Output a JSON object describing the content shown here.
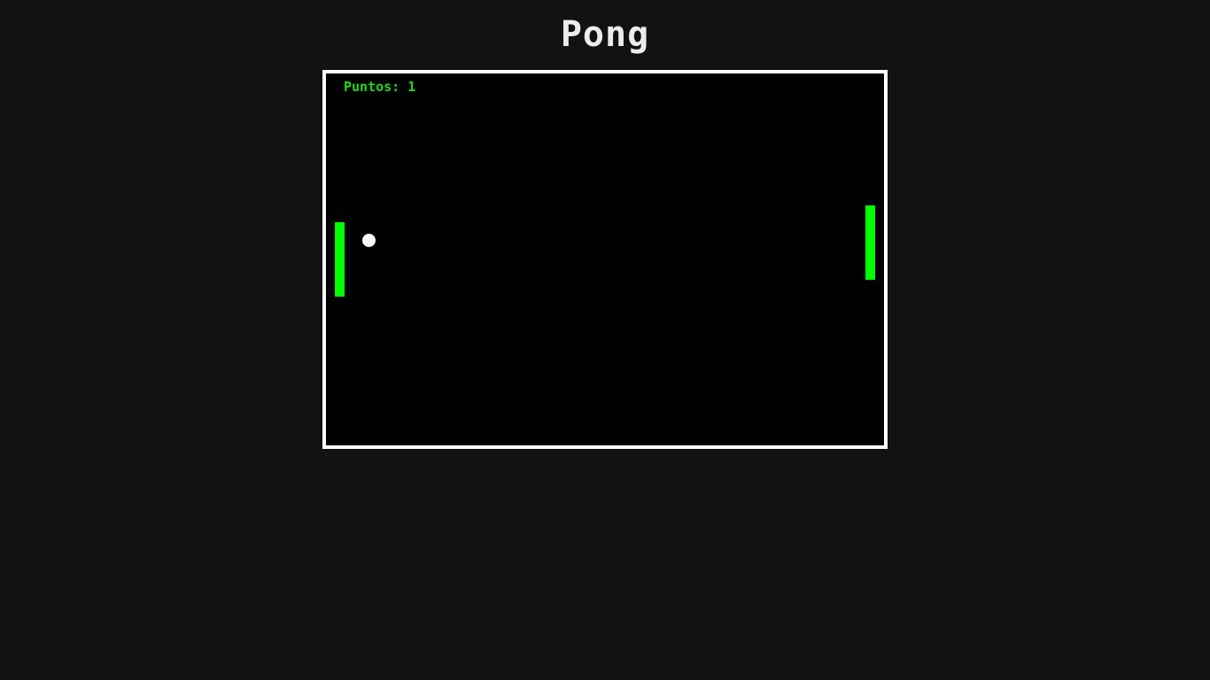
{
  "title": "Pong",
  "game": {
    "score_label": "Puntos:",
    "score_value": "1",
    "colors": {
      "background": "#121212",
      "board": "#000000",
      "border": "#ffffff",
      "paddle": "#00ff00",
      "ball": "#ffffff",
      "score_text": "#22d81a"
    }
  }
}
